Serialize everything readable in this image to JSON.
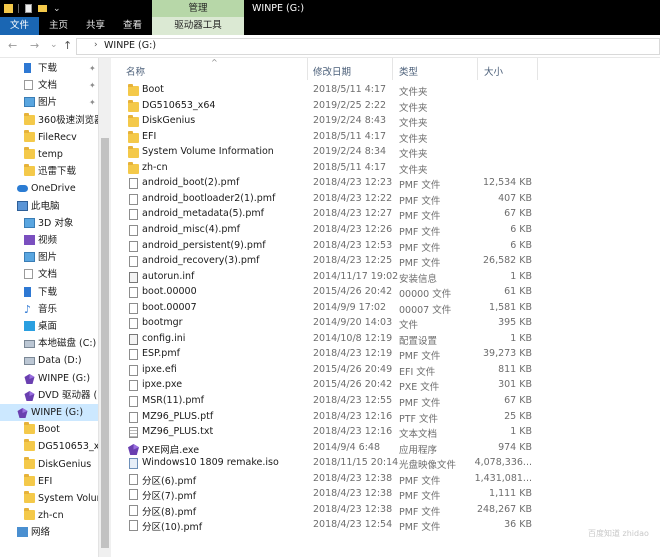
{
  "window": {
    "manage_tab": "管理",
    "title": "WINPE (G:)"
  },
  "ribbon": {
    "tabs": [
      "文件",
      "主页",
      "共享",
      "查看",
      "驱动器工具"
    ]
  },
  "address": {
    "path": "WINPE (G:)"
  },
  "columns": {
    "name": "名称",
    "date": "修改日期",
    "type": "类型",
    "size": "大小"
  },
  "navpane": [
    {
      "label": "下载",
      "icon": "download-icon",
      "pinned": true
    },
    {
      "label": "文档",
      "icon": "document-icon",
      "pinned": true
    },
    {
      "label": "图片",
      "icon": "picture-icon",
      "pinned": true
    },
    {
      "label": "360极速浏览器下",
      "icon": "folder-icon",
      "pinned": false
    },
    {
      "label": "FileRecv",
      "icon": "folder-icon",
      "pinned": false
    },
    {
      "label": "temp",
      "icon": "folder-icon",
      "pinned": false
    },
    {
      "label": "迅雷下载",
      "icon": "folder-icon",
      "pinned": false
    },
    {
      "label": "OneDrive",
      "icon": "cloud-icon",
      "pinned": false
    },
    {
      "label": "此电脑",
      "icon": "pc-icon",
      "pinned": false
    },
    {
      "label": "3D 对象",
      "icon": "cube-icon",
      "pinned": false
    },
    {
      "label": "视频",
      "icon": "video-icon",
      "pinned": false
    },
    {
      "label": "图片",
      "icon": "picture-icon",
      "pinned": false
    },
    {
      "label": "文档",
      "icon": "document-icon",
      "pinned": false
    },
    {
      "label": "下载",
      "icon": "download-icon",
      "pinned": false
    },
    {
      "label": "音乐",
      "icon": "music-icon",
      "pinned": false
    },
    {
      "label": "桌面",
      "icon": "desktop-icon",
      "pinned": false
    },
    {
      "label": "本地磁盘 (C:)",
      "icon": "disk-icon",
      "pinned": false
    },
    {
      "label": "Data (D:)",
      "icon": "disk-icon",
      "pinned": false
    },
    {
      "label": "WINPE (G:)",
      "icon": "winpe-drive-icon",
      "pinned": false
    },
    {
      "label": "DVD 驱动器 (H:)",
      "icon": "winpe-drive-icon",
      "pinned": false
    },
    {
      "label": "WINPE (G:)",
      "icon": "winpe-drive-icon",
      "pinned": false,
      "selected": true
    },
    {
      "label": "Boot",
      "icon": "folder-icon",
      "pinned": false
    },
    {
      "label": "DG510653_x64",
      "icon": "folder-icon",
      "pinned": false
    },
    {
      "label": "DiskGenius",
      "icon": "folder-icon",
      "pinned": false
    },
    {
      "label": "EFI",
      "icon": "folder-icon",
      "pinned": false
    },
    {
      "label": "System Volume",
      "icon": "folder-icon",
      "pinned": false
    },
    {
      "label": "zh-cn",
      "icon": "folder-icon",
      "pinned": false
    },
    {
      "label": "网络",
      "icon": "network-icon",
      "pinned": false
    }
  ],
  "files": [
    {
      "name": "Boot",
      "date": "2018/5/11 4:17",
      "type": "文件夹",
      "size": "",
      "icon": "folder-icon"
    },
    {
      "name": "DG510653_x64",
      "date": "2019/2/25 2:22",
      "type": "文件夹",
      "size": "",
      "icon": "folder-icon"
    },
    {
      "name": "DiskGenius",
      "date": "2019/2/24 8:43",
      "type": "文件夹",
      "size": "",
      "icon": "folder-icon"
    },
    {
      "name": "EFI",
      "date": "2018/5/11 4:17",
      "type": "文件夹",
      "size": "",
      "icon": "folder-icon"
    },
    {
      "name": "System Volume Information",
      "date": "2019/2/24 8:34",
      "type": "文件夹",
      "size": "",
      "icon": "folder-icon"
    },
    {
      "name": "zh-cn",
      "date": "2018/5/11 4:17",
      "type": "文件夹",
      "size": "",
      "icon": "folder-icon"
    },
    {
      "name": "android_boot(2).pmf",
      "date": "2018/4/23 12:23",
      "type": "PMF 文件",
      "size": "12,534 KB",
      "icon": "file-icon"
    },
    {
      "name": "android_bootloader2(1).pmf",
      "date": "2018/4/23 12:22",
      "type": "PMF 文件",
      "size": "407 KB",
      "icon": "file-icon"
    },
    {
      "name": "android_metadata(5).pmf",
      "date": "2018/4/23 12:27",
      "type": "PMF 文件",
      "size": "67 KB",
      "icon": "file-icon"
    },
    {
      "name": "android_misc(4).pmf",
      "date": "2018/4/23 12:26",
      "type": "PMF 文件",
      "size": "6 KB",
      "icon": "file-icon"
    },
    {
      "name": "android_persistent(9).pmf",
      "date": "2018/4/23 12:53",
      "type": "PMF 文件",
      "size": "6 KB",
      "icon": "file-icon"
    },
    {
      "name": "android_recovery(3).pmf",
      "date": "2018/4/23 12:25",
      "type": "PMF 文件",
      "size": "26,582 KB",
      "icon": "file-icon"
    },
    {
      "name": "autorun.inf",
      "date": "2014/11/17 19:02",
      "type": "安装信息",
      "size": "1 KB",
      "icon": "settings-file-icon"
    },
    {
      "name": "boot.00000",
      "date": "2015/4/26 20:42",
      "type": "00000 文件",
      "size": "61 KB",
      "icon": "file-icon"
    },
    {
      "name": "boot.00007",
      "date": "2014/9/9 17:02",
      "type": "00007 文件",
      "size": "1,581 KB",
      "icon": "file-icon"
    },
    {
      "name": "bootmgr",
      "date": "2014/9/20 14:03",
      "type": "文件",
      "size": "395 KB",
      "icon": "file-icon"
    },
    {
      "name": "config.ini",
      "date": "2014/10/8 12:19",
      "type": "配置设置",
      "size": "1 KB",
      "icon": "settings-file-icon"
    },
    {
      "name": "ESP.pmf",
      "date": "2018/4/23 12:19",
      "type": "PMF 文件",
      "size": "39,273 KB",
      "icon": "file-icon"
    },
    {
      "name": "ipxe.efi",
      "date": "2015/4/26 20:49",
      "type": "EFI 文件",
      "size": "811 KB",
      "icon": "file-icon"
    },
    {
      "name": "ipxe.pxe",
      "date": "2015/4/26 20:42",
      "type": "PXE 文件",
      "size": "301 KB",
      "icon": "file-icon"
    },
    {
      "name": "MSR(11).pmf",
      "date": "2018/4/23 12:55",
      "type": "PMF 文件",
      "size": "67 KB",
      "icon": "file-icon"
    },
    {
      "name": "MZ96_PLUS.ptf",
      "date": "2018/4/23 12:16",
      "type": "PTF 文件",
      "size": "25 KB",
      "icon": "file-icon"
    },
    {
      "name": "MZ96_PLUS.txt",
      "date": "2018/4/23 12:16",
      "type": "文本文档",
      "size": "1 KB",
      "icon": "text-file-icon"
    },
    {
      "name": "PXE网启.exe",
      "date": "2014/9/4 6:48",
      "type": "应用程序",
      "size": "974 KB",
      "icon": "app-icon"
    },
    {
      "name": "Windows10 1809 remake.iso",
      "date": "2018/11/15 20:14",
      "type": "光盘映像文件",
      "size": "4,078,336...",
      "icon": "disc-image-icon"
    },
    {
      "name": "分区(6).pmf",
      "date": "2018/4/23 12:38",
      "type": "PMF 文件",
      "size": "1,431,081...",
      "icon": "file-icon"
    },
    {
      "name": "分区(7).pmf",
      "date": "2018/4/23 12:38",
      "type": "PMF 文件",
      "size": "1,111 KB",
      "icon": "file-icon"
    },
    {
      "name": "分区(8).pmf",
      "date": "2018/4/23 12:38",
      "type": "PMF 文件",
      "size": "248,267 KB",
      "icon": "file-icon"
    },
    {
      "name": "分区(10).pmf",
      "date": "2018/4/23 12:54",
      "type": "PMF 文件",
      "size": "36 KB",
      "icon": "file-icon"
    }
  ],
  "watermark": "百度知道 zhidao"
}
